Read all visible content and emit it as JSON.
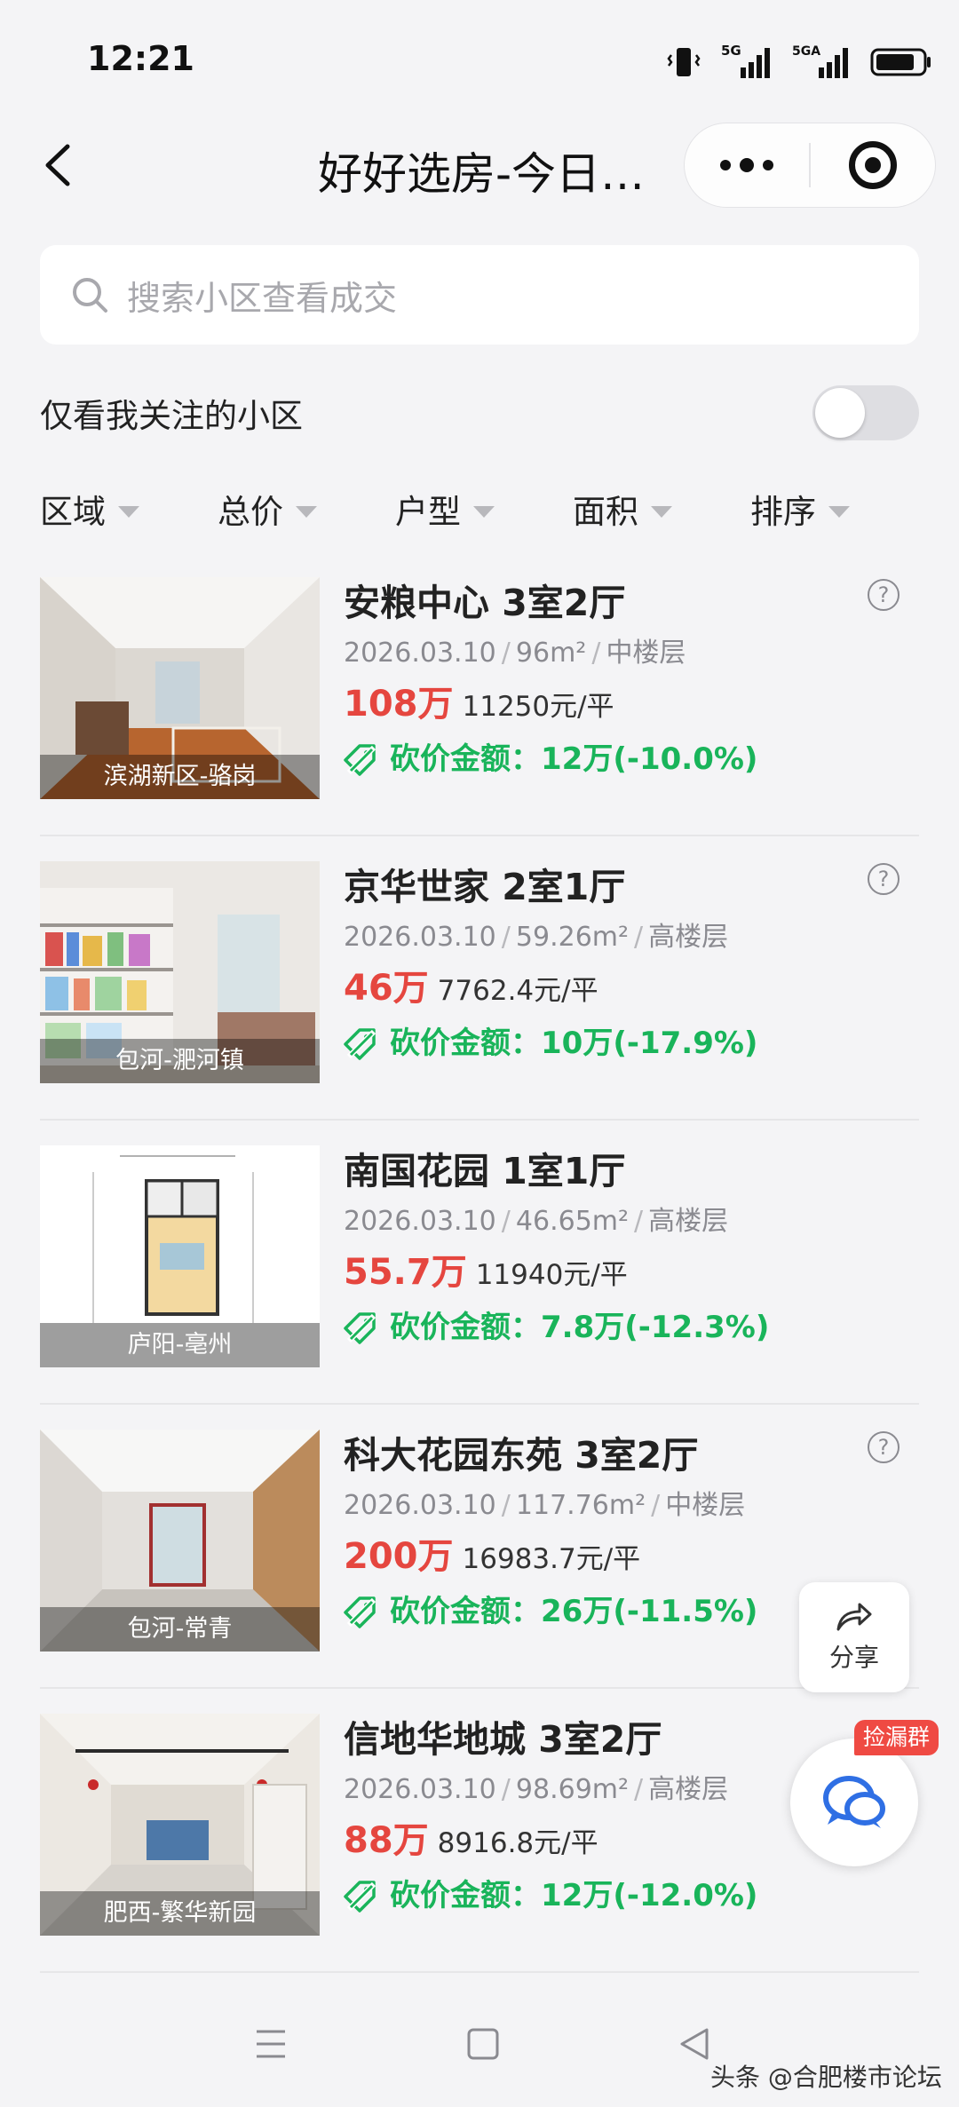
{
  "status_bar": {
    "time": "12:21",
    "network_1": "5G",
    "network_2": "5GA"
  },
  "header": {
    "title": "好好选房-今日…"
  },
  "search": {
    "placeholder": "搜索小区查看成交"
  },
  "follow_filter": {
    "label": "仅看我关注的小区",
    "enabled": false
  },
  "filters": [
    {
      "label": "区域"
    },
    {
      "label": "总价"
    },
    {
      "label": "户型"
    },
    {
      "label": "面积"
    },
    {
      "label": "排序"
    }
  ],
  "listings": [
    {
      "title": "安粮中心 3室2厅",
      "date": "2026.03.10",
      "area": "96m²",
      "floor": "中楼层",
      "price": "108万",
      "unit_price": "11250元/平",
      "cut": "砍价金额：12万(-10.0%)",
      "location": "滨湖新区-骆岗",
      "thumb_icon": "living-room-photo"
    },
    {
      "title": "京华世家 2室1厅",
      "date": "2026.03.10",
      "area": "59.26m²",
      "floor": "高楼层",
      "price": "46万",
      "unit_price": "7762.4元/平",
      "cut": "砍价金额：10万(-17.9%)",
      "location": "包河-淝河镇",
      "thumb_icon": "bookshelf-room-photo"
    },
    {
      "title": "南国花园 1室1厅",
      "date": "2026.03.10",
      "area": "46.65m²",
      "floor": "高楼层",
      "price": "55.7万",
      "unit_price": "11940元/平",
      "cut": "砍价金额：7.8万(-12.3%)",
      "location": "庐阳-亳州",
      "thumb_icon": "floor-plan"
    },
    {
      "title": "科大花园东苑 3室2厅",
      "date": "2026.03.10",
      "area": "117.76m²",
      "floor": "中楼层",
      "price": "200万",
      "unit_price": "16983.7元/平",
      "cut": "砍价金额：26万(-11.5%)",
      "location": "包河-常青",
      "thumb_icon": "empty-room-photo"
    },
    {
      "title": "信地华地城 3室2厅",
      "date": "2026.03.10",
      "area": "98.69m²",
      "floor": "高楼层",
      "price": "88万",
      "unit_price": "8916.8元/平",
      "cut": "砍价金额：12万(-12.0%)",
      "location": "肥西-繁华新园",
      "thumb_icon": "decorated-room-photo"
    }
  ],
  "floating": {
    "share_label": "分享",
    "chat_badge": "捡漏群"
  },
  "credit": "头条 @合肥楼市论坛",
  "colors": {
    "price_red": "#e5463f",
    "cut_green": "#19b45a",
    "background": "#f4f4f6"
  }
}
